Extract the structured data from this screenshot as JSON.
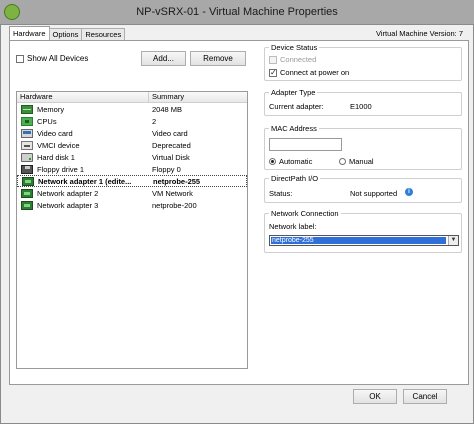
{
  "window": {
    "title": "NP-vSRX-01 - Virtual Machine Properties",
    "vm_version": "Virtual Machine Version: 7"
  },
  "tabs": [
    {
      "label": "Hardware",
      "active": true
    },
    {
      "label": "Options",
      "active": false
    },
    {
      "label": "Resources",
      "active": false
    }
  ],
  "hardware_panel": {
    "show_all_devices_label": "Show All Devices",
    "show_all_devices_checked": false,
    "add_label": "Add...",
    "remove_label": "Remove",
    "columns": [
      "Hardware",
      "Summary"
    ],
    "rows": [
      {
        "icon": "memory-icon",
        "name": "Memory",
        "summary": "2048 MB",
        "selected": false
      },
      {
        "icon": "cpu-icon",
        "name": "CPUs",
        "summary": "2",
        "selected": false
      },
      {
        "icon": "video-card-icon",
        "name": "Video card",
        "summary": "Video card",
        "selected": false
      },
      {
        "icon": "vmci-device-icon",
        "name": "VMCI device",
        "summary": "Deprecated",
        "selected": false
      },
      {
        "icon": "hard-disk-icon",
        "name": "Hard disk 1",
        "summary": "Virtual Disk",
        "selected": false
      },
      {
        "icon": "floppy-drive-icon",
        "name": "Floppy drive 1",
        "summary": "Floppy 0",
        "selected": false
      },
      {
        "icon": "network-adapter-icon",
        "name": "Network adapter 1 (edite...",
        "summary": "netprobe-255",
        "selected": true
      },
      {
        "icon": "network-adapter-icon",
        "name": "Network adapter 2",
        "summary": "VM Network",
        "selected": false
      },
      {
        "icon": "network-adapter-icon",
        "name": "Network adapter 3",
        "summary": "netprobe-200",
        "selected": false
      }
    ]
  },
  "device_status": {
    "title": "Device Status",
    "connected_label": "Connected",
    "connected_checked": false,
    "power_on_label": "Connect at power on",
    "power_on_checked": true
  },
  "adapter_type": {
    "title": "Adapter Type",
    "current_label": "Current adapter:",
    "current_value": "E1000"
  },
  "mac_address": {
    "title": "MAC Address",
    "value": "",
    "automatic_label": "Automatic",
    "manual_label": "Manual",
    "selected": "automatic"
  },
  "directpath": {
    "title": "DirectPath I/O",
    "status_label": "Status:",
    "status_value": "Not supported"
  },
  "network_connection": {
    "title": "Network Connection",
    "label": "Network label:",
    "selected_value": "netprobe-255"
  },
  "footer": {
    "ok_label": "OK",
    "cancel_label": "Cancel"
  },
  "colors": {
    "selection_blue": "#2f6fd8",
    "info_blue": "#2f7fd8",
    "titlebar_gray": "#a8a8a8"
  }
}
